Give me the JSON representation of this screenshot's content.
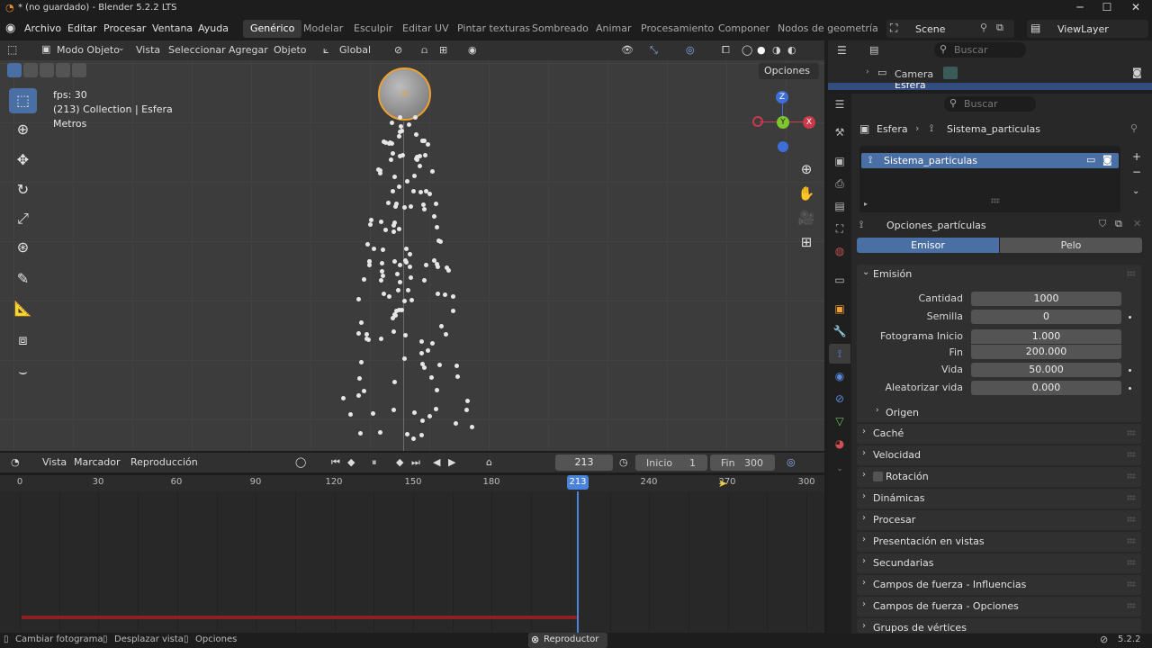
{
  "window": {
    "title": "* (no guardado) - Blender 5.2.2 LTS"
  },
  "menu": [
    "Archivo",
    "Editar",
    "Procesar",
    "Ventana",
    "Ayuda"
  ],
  "workspaces": [
    "Genérico",
    "Modelar",
    "Esculpir",
    "Editar UV",
    "Pintar texturas",
    "Sombreado",
    "Animar",
    "Procesamiento",
    "Componer",
    "Nodos de geometría"
  ],
  "scene": {
    "name": "Scene",
    "view_layer": "ViewLayer"
  },
  "viewport": {
    "mode": "Modo Objeto",
    "menus": [
      "Vista",
      "Seleccionar",
      "Agregar",
      "Objeto"
    ],
    "transform": "Global",
    "options": "Opciones",
    "overlay_lines": [
      "fps: 30",
      "(213) Collection | Esfera",
      "Metros"
    ],
    "gizmo": {
      "z": "Z",
      "y": "Y",
      "x": "X"
    }
  },
  "timeline": {
    "menus": [
      "Vista",
      "Marcador",
      "Reproducción"
    ],
    "current_frame": "213",
    "start_label": "Inicio",
    "start": "1",
    "end_label": "Fin",
    "end": "300",
    "ticks": [
      "0",
      "30",
      "60",
      "90",
      "120",
      "150",
      "180",
      "213",
      "240",
      "270",
      "300"
    ]
  },
  "statusbar": {
    "items": [
      "Cambiar fotograma",
      "Desplazar vista",
      "Opciones"
    ],
    "center": "Reproductor ...",
    "version": "5.2.2"
  },
  "outliner": {
    "search_placeholder": "Buscar",
    "items": [
      "Camera",
      "Esfera"
    ]
  },
  "properties": {
    "search_placeholder": "Buscar",
    "breadcrumb": [
      "Esfera",
      "Sistema_particulas"
    ],
    "system_list": [
      "Sistema_particulas"
    ],
    "settings_name": "Opciones_partículas",
    "type_tabs": [
      "Emisor",
      "Pelo"
    ],
    "active_type": "Emisor",
    "emission": {
      "title": "Emisión",
      "rows": [
        {
          "label": "Cantidad",
          "value": "1000"
        },
        {
          "label": "Semilla",
          "value": "0"
        },
        {
          "label": "Fotograma  Inicio",
          "value": "1.000"
        },
        {
          "label": "Fin",
          "value": "200.000"
        },
        {
          "label": "Vida",
          "value": "50.000"
        },
        {
          "label": "Aleatorizar vida",
          "value": "0.000"
        }
      ],
      "sub": "Origen"
    },
    "panels": [
      "Caché",
      "Velocidad",
      "Rotación",
      "Dinámicas",
      "Procesar",
      "Presentación en vistas",
      "Secundarias",
      "Campos de fuerza - Influencias",
      "Campos de fuerza - Opciones",
      "Grupos de vértices"
    ]
  },
  "colors": {
    "accent": "#4a6fa5",
    "playhead": "#4a83d9",
    "active_object": "#f0a030"
  }
}
